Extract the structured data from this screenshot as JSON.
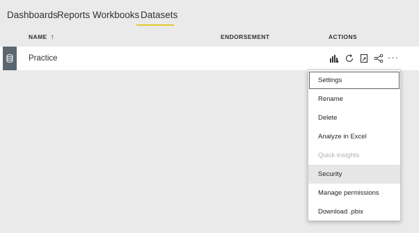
{
  "tabs": [
    {
      "label": "Dashboards"
    },
    {
      "label": "Reports"
    },
    {
      "label": "Workbooks"
    },
    {
      "label": "Datasets",
      "active": true
    }
  ],
  "table": {
    "headers": {
      "name": "NAME",
      "name_sort": "↑",
      "endorsement": "ENDORSEMENT",
      "actions": "ACTIONS"
    },
    "rows": [
      {
        "name": "Practice",
        "icon": "database-icon"
      }
    ],
    "actions": [
      "create-report-icon",
      "refresh-icon",
      "schedule-refresh-icon",
      "share-icon",
      "more-options-icon"
    ],
    "more_label": "···"
  },
  "context_menu": {
    "items": [
      {
        "label": "Settings",
        "state": "focused"
      },
      {
        "label": "Rename"
      },
      {
        "label": "Delete"
      },
      {
        "label": "Analyze in Excel"
      },
      {
        "label": "Quick insights",
        "state": "disabled"
      },
      {
        "label": "Security",
        "state": "hover"
      },
      {
        "label": "Manage permissions"
      },
      {
        "label": "Download .pbix"
      }
    ]
  },
  "colors": {
    "active_tab_underline": "#e3c72c",
    "page_background": "#eaeaea",
    "row_icon_background": "#5b6770"
  }
}
